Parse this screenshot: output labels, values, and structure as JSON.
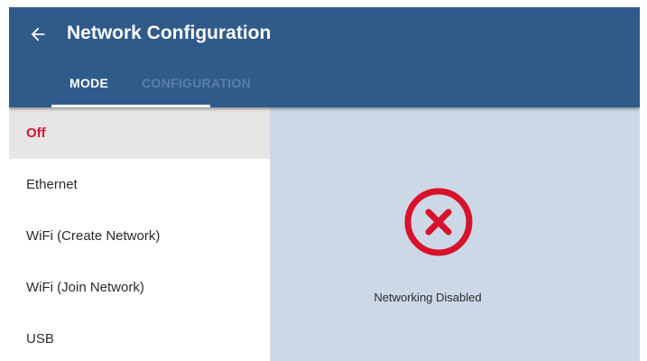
{
  "header": {
    "title": "Network Configuration",
    "back_icon": "arrow-left-icon",
    "background_color": "#2f5b8a"
  },
  "tabs": [
    {
      "label": "MODE",
      "active": true
    },
    {
      "label": "CONFIGURATION",
      "active": false
    }
  ],
  "sidebar": {
    "items": [
      {
        "label": "Off",
        "selected": true
      },
      {
        "label": "Ethernet",
        "selected": false
      },
      {
        "label": "WiFi (Create Network)",
        "selected": false
      },
      {
        "label": "WiFi (Join Network)",
        "selected": false
      },
      {
        "label": "USB",
        "selected": false
      }
    ]
  },
  "status": {
    "icon": "error-x-circle-icon",
    "icon_color": "#d7122a",
    "text": "Networking Disabled"
  }
}
